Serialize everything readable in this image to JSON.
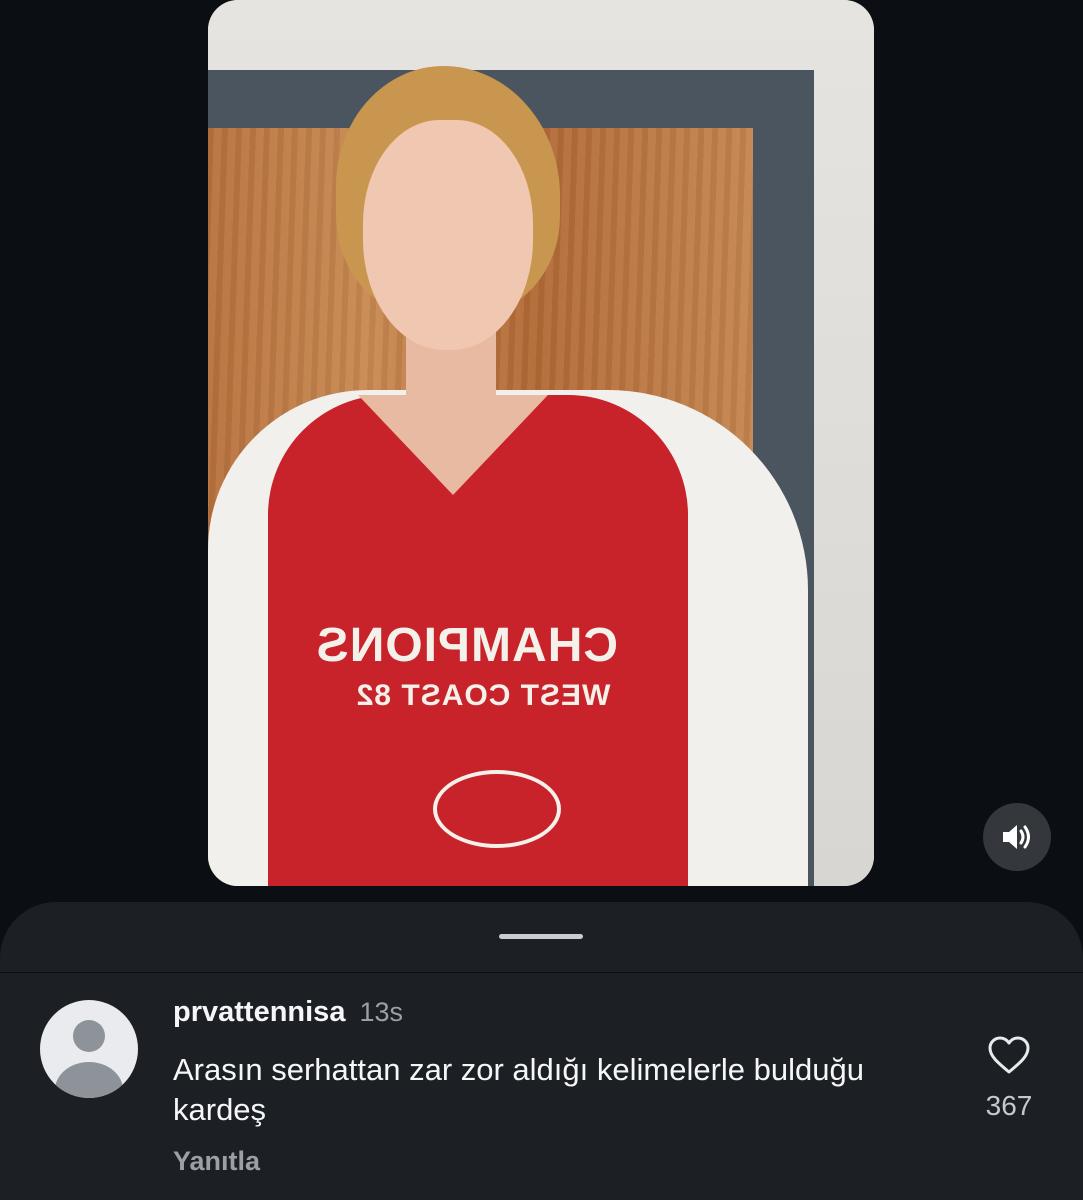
{
  "video": {
    "shirt_text_line1": "CHAMPIONS",
    "shirt_text_line2": "WEST COAST 82"
  },
  "controls": {
    "sound_icon": "speaker-volume-icon"
  },
  "comment": {
    "username": "prvattennisa",
    "time": "13s",
    "text": "Arasın serhattan zar zor aldığı kelimelerle bulduğu kardeş",
    "reply_label": "Yanıtla",
    "like_count": "367",
    "like_icon": "heart-outline-icon",
    "avatar_icon": "default-avatar-icon"
  },
  "colors": {
    "background": "#0b0f14",
    "sheet": "#1c1f24",
    "muted_text": "#9aa0a6"
  }
}
